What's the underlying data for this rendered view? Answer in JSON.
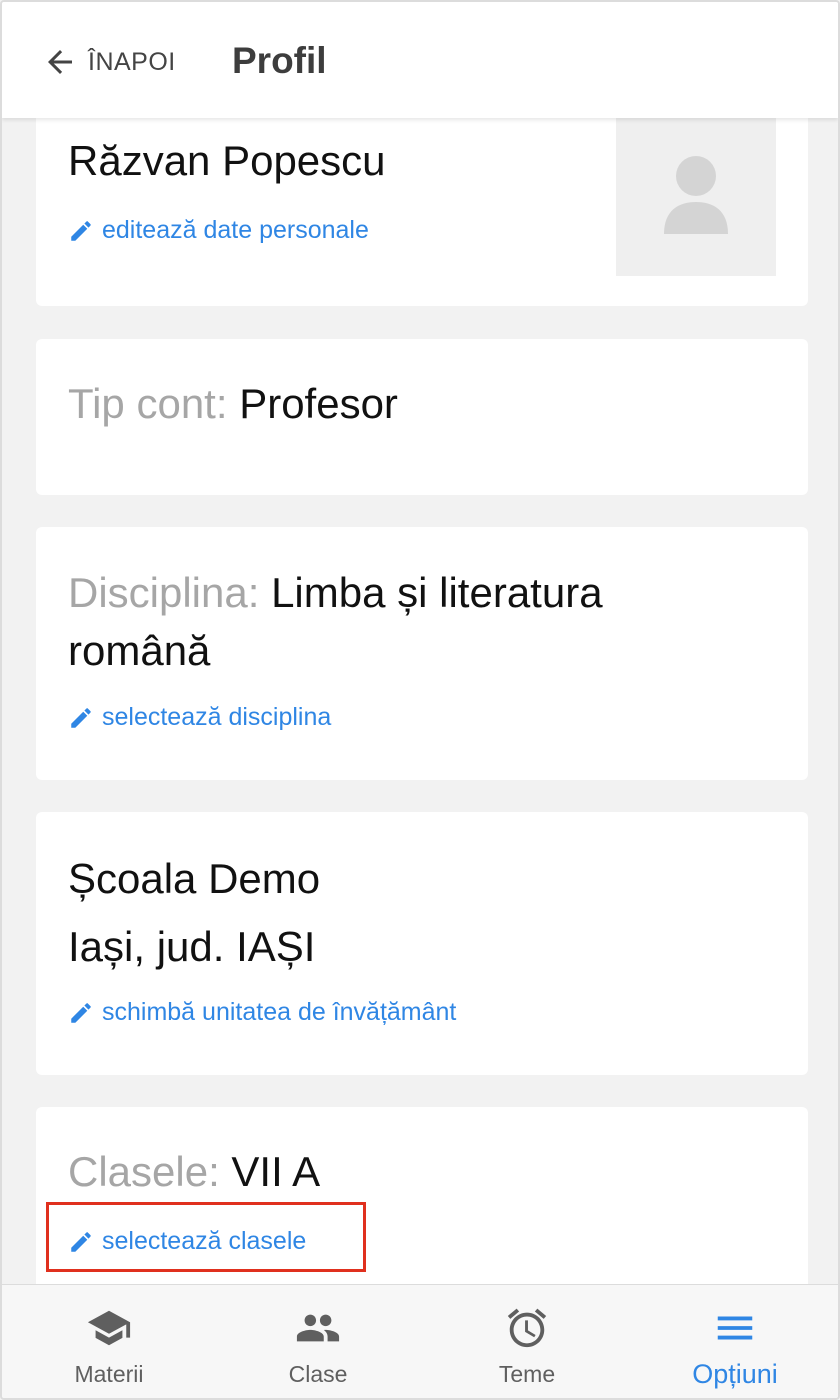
{
  "header": {
    "back_label": "ÎNAPOI",
    "title": "Profil"
  },
  "profile": {
    "name": "Răzvan Popescu",
    "edit_personal": "editează date personale"
  },
  "account": {
    "label": "Tip cont:",
    "value": "Profesor"
  },
  "discipline": {
    "label": "Disciplina:",
    "value_line1": "Limba și literatura",
    "value_line2": "română",
    "edit": "selectează disciplina"
  },
  "school": {
    "name": "Școala Demo",
    "location": "Iași, jud. IAȘI",
    "edit": "schimbă unitatea de învățământ"
  },
  "classes": {
    "label": "Clasele:",
    "value": "VII A",
    "edit": "selectează clasele"
  },
  "tabbar": {
    "tabs": [
      {
        "label": "Materii",
        "icon": "graduation-cap-icon"
      },
      {
        "label": "Clase",
        "icon": "people-icon"
      },
      {
        "label": "Teme",
        "icon": "alarm-clock-icon"
      },
      {
        "label": "Opțiuni",
        "icon": "menu-icon"
      }
    ],
    "active_index": 3
  },
  "colors": {
    "accent": "#2f86e4",
    "highlight_border": "#e0301e",
    "muted_text": "#a6a6a6"
  }
}
